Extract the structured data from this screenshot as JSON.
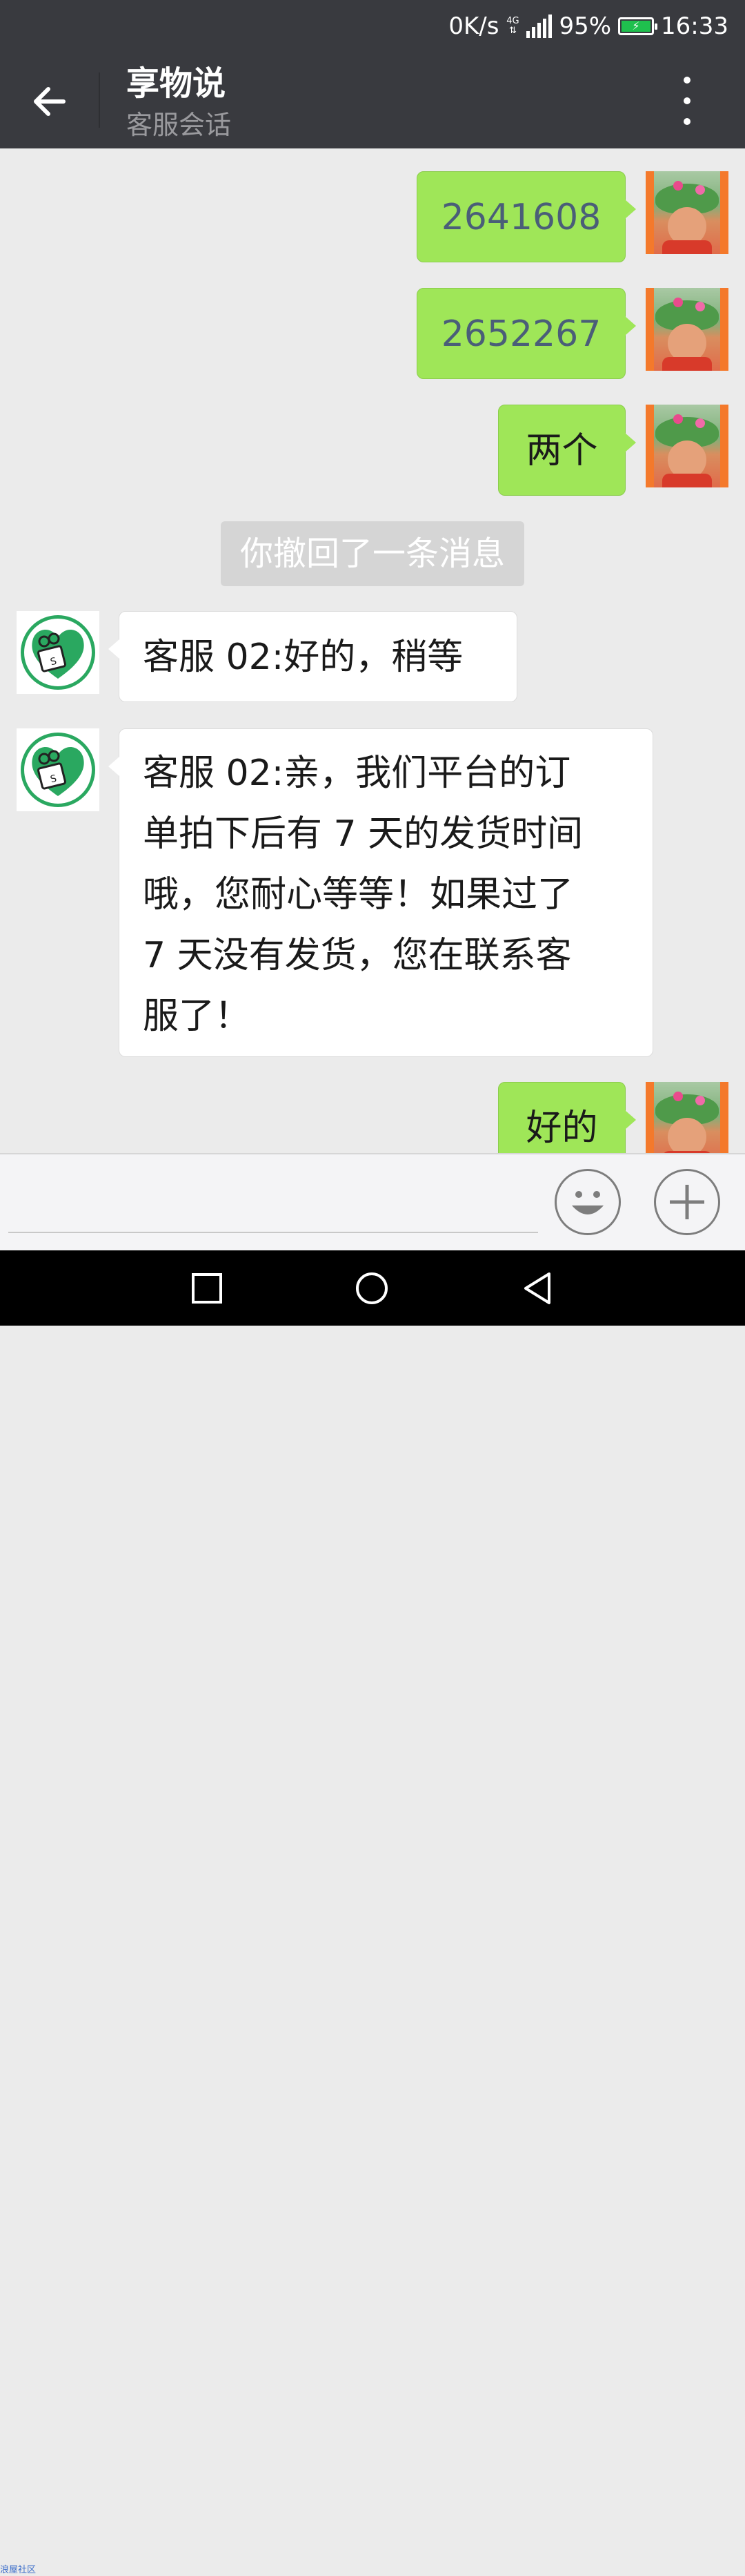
{
  "status_bar": {
    "network_speed": "0K/s",
    "network_type": "4G",
    "battery": "95%",
    "time": "16:33"
  },
  "header": {
    "title": "享物说",
    "subtitle": "客服会话"
  },
  "messages": [
    {
      "sender": "me",
      "text": "2641608"
    },
    {
      "sender": "me",
      "text": "2652267"
    },
    {
      "sender": "me",
      "text": "两个"
    },
    {
      "sender": "system",
      "text": "你撤回了一条消息"
    },
    {
      "sender": "service",
      "text": "客服 02:好的，稍等"
    },
    {
      "sender": "service",
      "lines": [
        "客服 02:亲，我们平台的订",
        "单拍下后有 7 天的发货时间",
        "哦，您耐心等等！如果过了",
        "7 天没有发货，您在联系客",
        "服了！"
      ]
    },
    {
      "sender": "me",
      "text": "好的"
    }
  ],
  "input": {
    "placeholder": ""
  },
  "icons": {
    "back": "arrow-left-icon",
    "more": "more-vertical-icon",
    "emoji": "emoji-icon",
    "plus": "plus-icon",
    "nav_recent": "square-icon",
    "nav_home": "circle-icon",
    "nav_back": "triangle-back-icon"
  },
  "colors": {
    "header_bg": "#393a3f",
    "chat_bg": "#ebebeb",
    "my_bubble": "#9fe658",
    "service_bubble": "#ffffff",
    "brand_green": "#2aa860"
  },
  "watermark": "浪屋社区"
}
